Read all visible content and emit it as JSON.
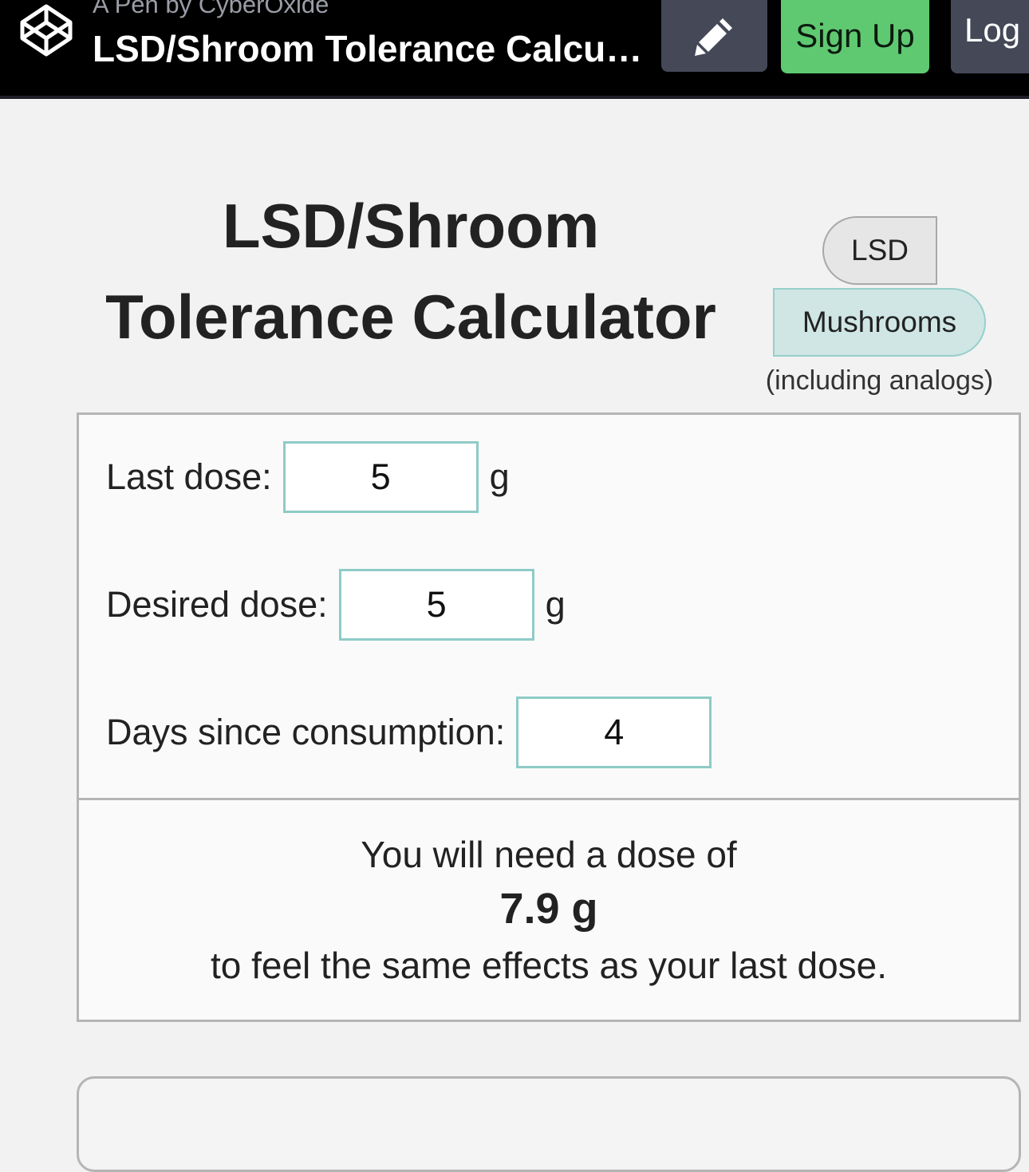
{
  "header": {
    "pen_by": "A Pen by CyberOxide",
    "title": "LSD/Shroom Tolerance Calcu…",
    "signup_label": "Sign Up",
    "login_label": "Log"
  },
  "calculator": {
    "heading_line1": "LSD/Shroom",
    "heading_line2": "Tolerance Calculator",
    "substance_options": [
      "LSD",
      "Mushrooms"
    ],
    "selected_substance": "Mushrooms",
    "analogs_note": "(including analogs)",
    "fields": [
      {
        "label": "Last dose:",
        "value": "5",
        "unit": "g"
      },
      {
        "label": "Desired dose:",
        "value": "5",
        "unit": "g"
      },
      {
        "label": "Days since consumption:",
        "value": "4"
      }
    ],
    "result": {
      "pre_text": "You will need a dose of",
      "value": "7.9 g",
      "post_text": "to feel the same effects as your last dose."
    }
  },
  "colors": {
    "topbar_bg": "#000000",
    "signup_green": "#5fc972",
    "dark_button": "#444857",
    "selected_toggle": "#cfe6e4",
    "input_border": "#8ecbc6"
  },
  "icons": {
    "logo": "codepen-cube-icon",
    "edit": "pencil-icon"
  }
}
